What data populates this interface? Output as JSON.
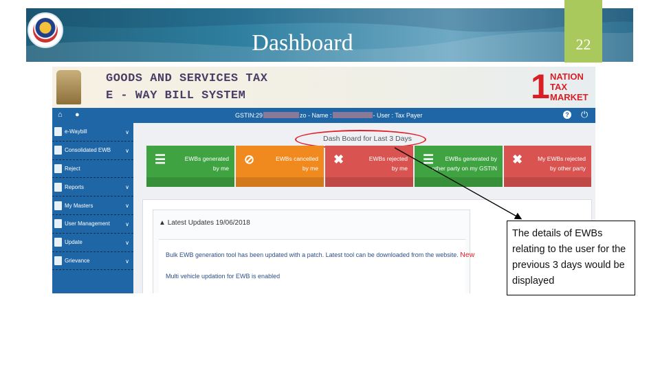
{
  "slide": {
    "title": "Dashboard",
    "page_number": "22"
  },
  "portal": {
    "title_line1": "GOODS AND SERVICES TAX",
    "title_line2": "E - WAY BILL SYSTEM",
    "badge_number": "1",
    "badge_text": [
      "NATION",
      "TAX",
      "MARKET"
    ],
    "gstin_prefix": "GSTIN:29",
    "name_label": "zo - Name :",
    "user_label": "- User : Tax Payer"
  },
  "sidebar": {
    "items": [
      {
        "label": "e-Waybill",
        "chevron": true
      },
      {
        "label": "Consolidated EWB",
        "chevron": true
      },
      {
        "label": "Reject",
        "chevron": false
      },
      {
        "label": "Reports",
        "chevron": true
      },
      {
        "label": "My Masters",
        "chevron": true
      },
      {
        "label": "User Management",
        "chevron": true
      },
      {
        "label": "Update",
        "chevron": true
      },
      {
        "label": "Grievance",
        "chevron": true
      }
    ]
  },
  "dashboard": {
    "title": "Dash Board for Last 3 Days",
    "cards": [
      {
        "line1": "EWBs generated",
        "line2": "by me",
        "icon": "list-icon",
        "color": "#3fa342"
      },
      {
        "line1": "EWBs cancelled",
        "line2": "by me",
        "icon": "ban-icon",
        "color": "#f08a1f"
      },
      {
        "line1": "EWBs rejected",
        "line2": "by me",
        "icon": "x-icon",
        "color": "#d95451"
      },
      {
        "line1": "EWBs generated by",
        "line2": "other party on my GSTIN",
        "icon": "list-icon",
        "color": "#3fa342"
      },
      {
        "line1": "My EWBs rejected",
        "line2": "by other party",
        "icon": "x-icon",
        "color": "#d95451"
      }
    ]
  },
  "updates": {
    "header": "Latest Updates  19/06/2018",
    "line1": "Bulk EWB generation tool has been updated with a patch. Latest tool can be downloaded from the website.",
    "new_label": "New",
    "line2": "Multi vehicle updation for EWB is enabled"
  },
  "callout": {
    "text": "The details of EWBs relating to the user for the previous 3 days would be displayed"
  },
  "colors": {
    "navbar": "#1f66a6",
    "highlight": "#e41e26",
    "slide_accent": "#a9c95d"
  }
}
